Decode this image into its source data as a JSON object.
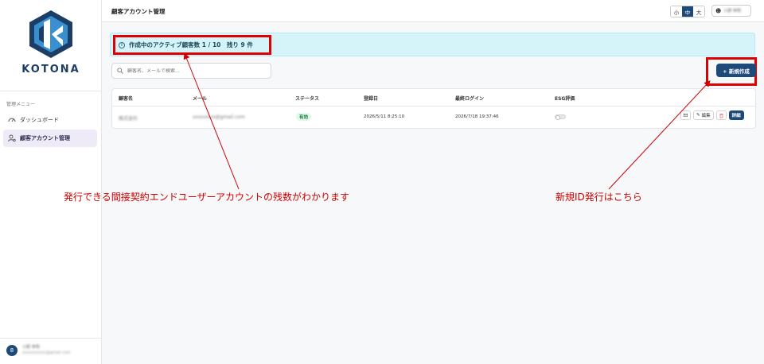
{
  "sidebar": {
    "logo_text": "KOTONA",
    "menu_title": "管理メニュー",
    "items": [
      {
        "label": "ダッシュボード",
        "icon": "dashboard-icon"
      },
      {
        "label": "顧客アカウント管理",
        "icon": "users-icon",
        "active": true
      }
    ],
    "user": {
      "avatar_initial": "8",
      "name": "小野 幸明",
      "email": "xxxxxxxxxx@gmail.com"
    }
  },
  "header": {
    "title": "顧客アカウント管理",
    "font_sizes": [
      "小",
      "中",
      "大"
    ],
    "selected_font_size": "中",
    "user_name": "小野 幸明"
  },
  "banner": {
    "text": "作成中のアクティブ顧客数 1 / 10　残り 9 件"
  },
  "search": {
    "placeholder": "顧客名、メールで検索..."
  },
  "new_button": {
    "label": "+ 新規作成"
  },
  "table": {
    "columns": [
      "顧客名",
      "メール",
      "ステータス",
      "登録日",
      "最終ログイン",
      "ESG評価"
    ],
    "rows": [
      {
        "name": "株式会社",
        "email": "xxxxxxxx@gmail.com",
        "status": "有効",
        "registered": "2026/5/11 8:25:10",
        "last_login": "2026/7/18 19:37:46",
        "esg_enabled": false,
        "actions": {
          "edit": "編集",
          "detail": "詳細"
        }
      }
    ]
  },
  "annotations": {
    "left": "発行できる間接契約エンドユーザーアカウントの残数がわかります",
    "right": "新規ID発行はこちら"
  },
  "colors": {
    "accent": "#1e4a7a",
    "annotation": "#e00000",
    "banner_bg": "#d5f4fa"
  }
}
